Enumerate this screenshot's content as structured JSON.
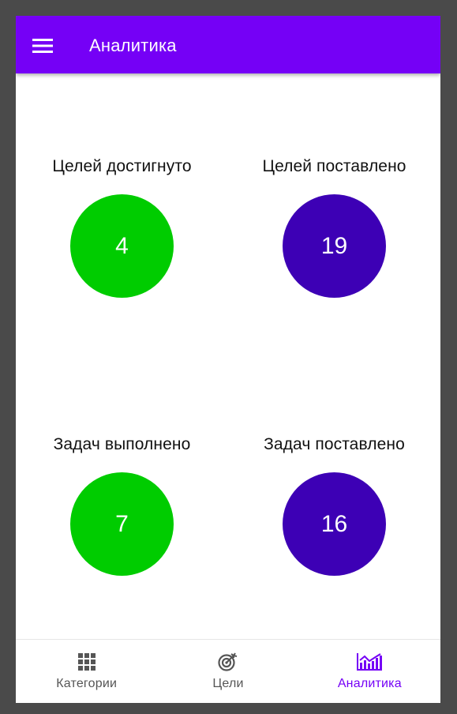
{
  "colors": {
    "primary": "#7500f6",
    "achieved": "#00cc00",
    "set": "#3d00b5",
    "nav_inactive": "#555555"
  },
  "appbar": {
    "menu_icon": "hamburger-menu-icon",
    "title": "Аналитика"
  },
  "stats": [
    {
      "label": "Целей достигнуто",
      "value": "4",
      "color": "#00cc00"
    },
    {
      "label": "Целей поставлено",
      "value": "19",
      "color": "#3d00b5"
    },
    {
      "label": "Задач выполнено",
      "value": "7",
      "color": "#00cc00"
    },
    {
      "label": "Задач поставлено",
      "value": "16",
      "color": "#3d00b5"
    }
  ],
  "bottom_nav": {
    "active": "analytics",
    "items": [
      {
        "id": "categories",
        "label": "Категории",
        "icon": "grid-icon"
      },
      {
        "id": "goals",
        "label": "Цели",
        "icon": "target-icon"
      },
      {
        "id": "analytics",
        "label": "Аналитика",
        "icon": "chart-icon"
      }
    ]
  }
}
